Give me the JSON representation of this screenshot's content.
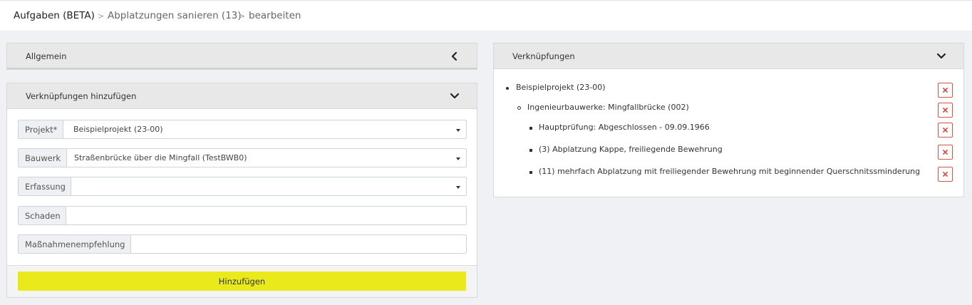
{
  "breadcrumb": {
    "items": [
      "Aufgaben (BETA)",
      "Abplatzungen sanieren (13)",
      "bearbeiten"
    ],
    "separator": ">"
  },
  "panels": {
    "allgemein": {
      "title": "Allgemein",
      "icon": "chevron-left-icon"
    },
    "add_links": {
      "title": "Verknüpfungen hinzufügen",
      "icon": "chevron-down-icon",
      "fields": [
        {
          "label": "Projekt*",
          "value": "Beispielprojekt (23-00)",
          "type": "select"
        },
        {
          "label": "Bauwerk",
          "value": "Straßenbrücke über die Mingfall (TestBWB0)",
          "type": "select"
        },
        {
          "label": "Erfassung",
          "value": "",
          "type": "select"
        },
        {
          "label": "Schaden",
          "value": "",
          "type": "text"
        },
        {
          "label": "Maßnahmenempfehlung",
          "value": "",
          "type": "text"
        }
      ],
      "submit_label": "Hinzufügen"
    },
    "links": {
      "title": "Verknüpfungen",
      "icon": "chevron-down-icon",
      "items": [
        {
          "text": "Beispielprojekt (23-00)",
          "level": 1
        },
        {
          "text": "Ingenieurbauwerke: Mingfallbrücke (002)",
          "level": 2
        },
        {
          "text": "Hauptprüfung: Abgeschlossen - 09.09.1966",
          "level": 3
        },
        {
          "text": "(3) Abplatzung Kappe, freiliegende Bewehrung",
          "level": 3
        },
        {
          "text": "(11) mehrfach Abplatzung mit freiliegender Bewehrung mit beginnender Querschnitssminderung",
          "level": 3
        }
      ],
      "delete_icon": "close-icon"
    }
  },
  "colors": {
    "accent": "#eae91c",
    "danger": "#d9534f",
    "background": "#f0f1f5"
  }
}
